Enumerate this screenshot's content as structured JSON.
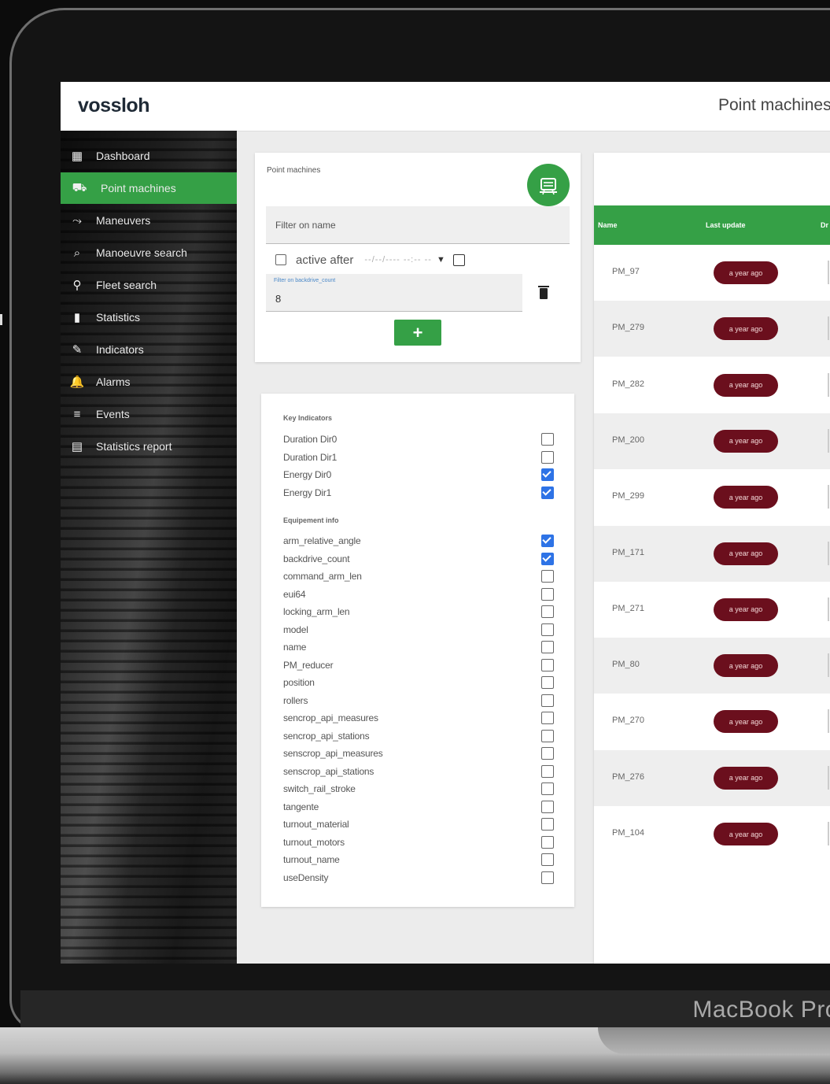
{
  "app": {
    "logo": "vossloh",
    "page_title": "Point machines",
    "device_label": "MacBook Pro"
  },
  "colors": {
    "brand_green": "#35a046",
    "badge_red": "#6b0f1d",
    "checkbox_blue": "#2e73e6"
  },
  "sidebar": {
    "items": [
      {
        "label": "Dashboard",
        "icon": "dashboard-icon",
        "active": false
      },
      {
        "label": "Point machines",
        "icon": "train-icon",
        "active": true
      },
      {
        "label": "Maneuvers",
        "icon": "route-icon",
        "active": false
      },
      {
        "label": "Manoeuvre search",
        "icon": "search-box-icon",
        "active": false
      },
      {
        "label": "Fleet search",
        "icon": "fleet-search-icon",
        "active": false
      },
      {
        "label": "Statistics",
        "icon": "bar-chart-icon",
        "active": false
      },
      {
        "label": "Indicators",
        "icon": "pen-icon",
        "active": false
      },
      {
        "label": "Alarms",
        "icon": "bell-icon",
        "active": false
      },
      {
        "label": "Events",
        "icon": "list-icon",
        "active": false
      },
      {
        "label": "Statistics report",
        "icon": "report-icon",
        "active": false
      }
    ]
  },
  "filter": {
    "title": "Point machines",
    "name_placeholder": "Filter on name",
    "active_after_label": "active after",
    "active_after_checked": false,
    "date_placeholder": "--/--/---- --:-- --",
    "backdrive_label": "Filter on backdrive_count",
    "backdrive_value": "8",
    "add_label": "+"
  },
  "indicators": {
    "key_heading": "Key Indicators",
    "key_items": [
      {
        "label": "Duration Dir0",
        "checked": false
      },
      {
        "label": "Duration Dir1",
        "checked": false
      },
      {
        "label": "Energy Dir0",
        "checked": true
      },
      {
        "label": "Energy Dir1",
        "checked": true
      }
    ],
    "equipment_heading": "Equipement info",
    "equipment_items": [
      {
        "label": "arm_relative_angle",
        "checked": true
      },
      {
        "label": "backdrive_count",
        "checked": true
      },
      {
        "label": "command_arm_len",
        "checked": false
      },
      {
        "label": "eui64",
        "checked": false
      },
      {
        "label": "locking_arm_len",
        "checked": false
      },
      {
        "label": "model",
        "checked": false
      },
      {
        "label": "name",
        "checked": false
      },
      {
        "label": "PM_reducer",
        "checked": false
      },
      {
        "label": "position",
        "checked": false
      },
      {
        "label": "rollers",
        "checked": false
      },
      {
        "label": "sencrop_api_measures",
        "checked": false
      },
      {
        "label": "sencrop_api_stations",
        "checked": false
      },
      {
        "label": "senscrop_api_measures",
        "checked": false
      },
      {
        "label": "senscrop_api_stations",
        "checked": false
      },
      {
        "label": "switch_rail_stroke",
        "checked": false
      },
      {
        "label": "tangente",
        "checked": false
      },
      {
        "label": "turnout_material",
        "checked": false
      },
      {
        "label": "turnout_motors",
        "checked": false
      },
      {
        "label": "turnout_name",
        "checked": false
      },
      {
        "label": "useDensity",
        "checked": false
      }
    ]
  },
  "table": {
    "columns": [
      "Name",
      "Last update",
      "Dr"
    ],
    "rows": [
      {
        "name": "PM_97",
        "last_update": "a year ago"
      },
      {
        "name": "PM_279",
        "last_update": "a year ago"
      },
      {
        "name": "PM_282",
        "last_update": "a year ago"
      },
      {
        "name": "PM_200",
        "last_update": "a year ago"
      },
      {
        "name": "PM_299",
        "last_update": "a year ago"
      },
      {
        "name": "PM_171",
        "last_update": "a year ago"
      },
      {
        "name": "PM_271",
        "last_update": "a year ago"
      },
      {
        "name": "PM_80",
        "last_update": "a year ago"
      },
      {
        "name": "PM_270",
        "last_update": "a year ago"
      },
      {
        "name": "PM_276",
        "last_update": "a year ago"
      },
      {
        "name": "PM_104",
        "last_update": "a year ago"
      }
    ]
  }
}
